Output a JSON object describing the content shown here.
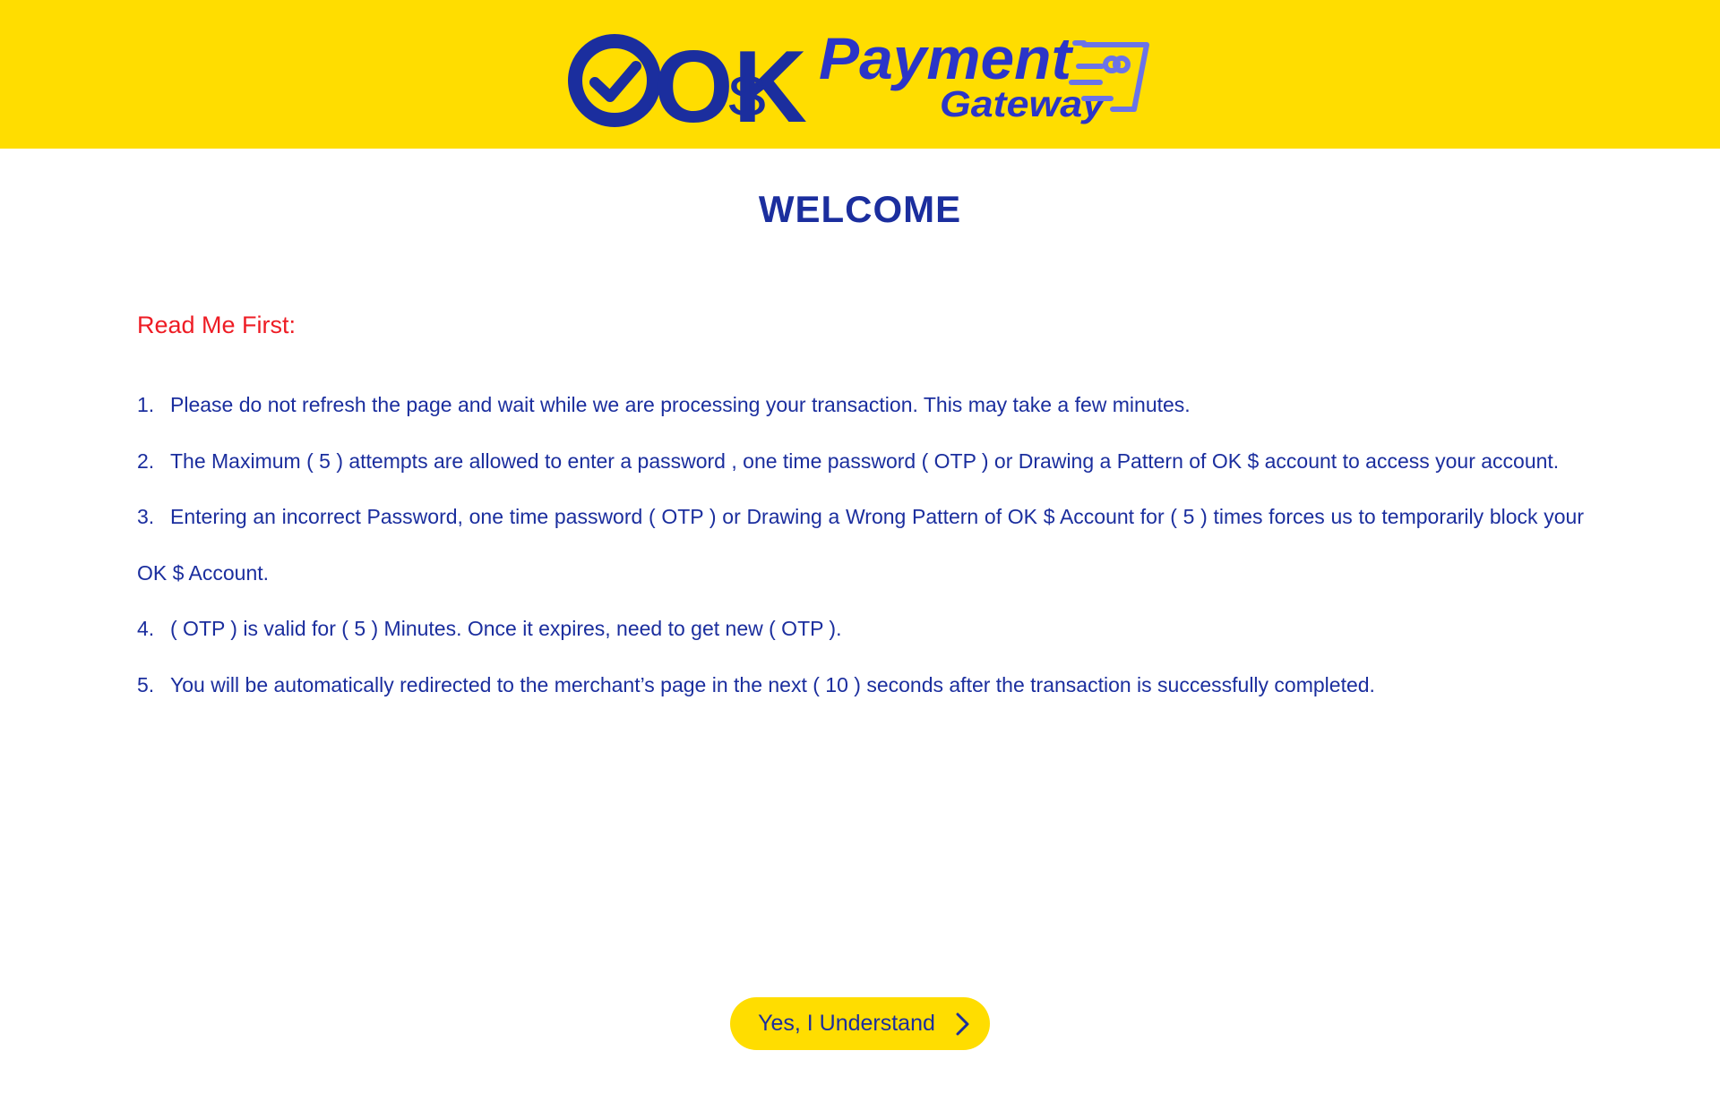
{
  "header": {
    "logo": {
      "brand": "OK",
      "currency_symbol": "$",
      "title_line1": "Payment",
      "title_line2": "Gateway",
      "card_icon": "card-icon"
    }
  },
  "main": {
    "title": "WELCOME",
    "read_first_label": "Read Me First:",
    "rules": [
      {
        "num": "1.",
        "text": "Please do not refresh the page and wait while we are processing your transaction. This may take a few minutes."
      },
      {
        "num": "2.",
        "text": "The Maximum ( 5 )  attempts are allowed to enter a password , one time password  ( OTP ) or Drawing a Pattern of OK $ account to access your account."
      },
      {
        "num": "3.",
        "text": "Entering an incorrect Password, one time password ( OTP ) or Drawing a Wrong Pattern of OK $ Account for ( 5 ) times forces us to temporarily block your OK $ Account."
      },
      {
        "num": "4.",
        "text": "( OTP ) is valid for ( 5 ) Minutes. Once it expires, need to get new ( OTP )."
      },
      {
        "num": "5.",
        "text": "You will be automatically redirected to the merchant’s page in the next  ( 10 ) seconds after the transaction is successfully completed."
      }
    ]
  },
  "cta": {
    "label": "Yes, I Understand",
    "icon": "chevron-right-icon"
  },
  "colors": {
    "brand_yellow": "#FFDD00",
    "brand_blue": "#1B2E9E",
    "alert_red": "#EE1C24",
    "card_violet": "#6B73E8"
  }
}
